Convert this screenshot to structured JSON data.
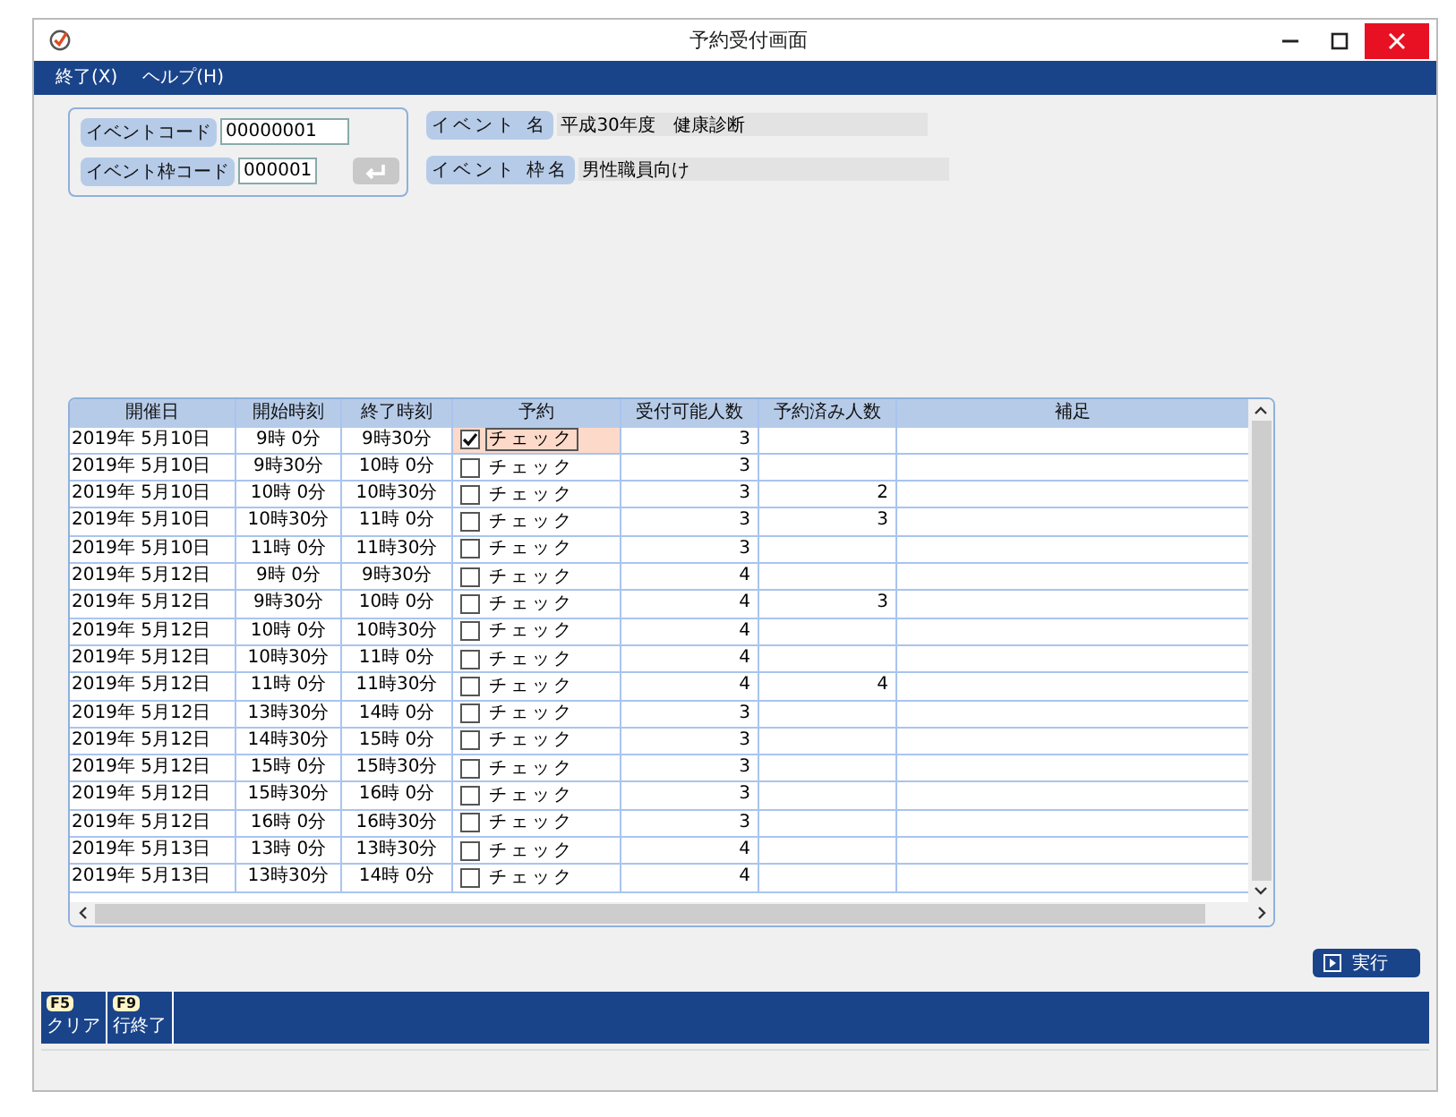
{
  "window": {
    "title": "予約受付画面"
  },
  "menu": [
    {
      "label": "終了(X)"
    },
    {
      "label": "ヘルプ(H)"
    }
  ],
  "form": {
    "event_code": {
      "label": "イベントコード",
      "value": "00000001"
    },
    "slot_code": {
      "label": "イベント枠コード",
      "value": "000001"
    },
    "event_name": {
      "label": "イベント 名",
      "value": "平成30年度　健康診断"
    },
    "slot_name": {
      "label": "イベント 枠名",
      "value": "男性職員向け"
    }
  },
  "table": {
    "columns": [
      "開催日",
      "開始時刻",
      "終了時刻",
      "予約",
      "受付可能人数",
      "予約済み人数",
      "補足"
    ],
    "rows": [
      {
        "date": "2019年 5月10日",
        "start": "9時 0分",
        "end": "9時30分",
        "check": "チェック",
        "checked": true,
        "selected": true,
        "capacity": "3",
        "booked": ""
      },
      {
        "date": "2019年 5月10日",
        "start": "9時30分",
        "end": "10時 0分",
        "check": "チェック",
        "checked": false,
        "selected": false,
        "capacity": "3",
        "booked": ""
      },
      {
        "date": "2019年 5月10日",
        "start": "10時 0分",
        "end": "10時30分",
        "check": "チェック",
        "checked": false,
        "selected": false,
        "capacity": "3",
        "booked": "2"
      },
      {
        "date": "2019年 5月10日",
        "start": "10時30分",
        "end": "11時 0分",
        "check": "チェック",
        "checked": false,
        "selected": false,
        "capacity": "3",
        "booked": "3"
      },
      {
        "date": "2019年 5月10日",
        "start": "11時 0分",
        "end": "11時30分",
        "check": "チェック",
        "checked": false,
        "selected": false,
        "capacity": "3",
        "booked": ""
      },
      {
        "date": "2019年 5月12日",
        "start": "9時 0分",
        "end": "9時30分",
        "check": "チェック",
        "checked": false,
        "selected": false,
        "capacity": "4",
        "booked": ""
      },
      {
        "date": "2019年 5月12日",
        "start": "9時30分",
        "end": "10時 0分",
        "check": "チェック",
        "checked": false,
        "selected": false,
        "capacity": "4",
        "booked": "3"
      },
      {
        "date": "2019年 5月12日",
        "start": "10時 0分",
        "end": "10時30分",
        "check": "チェック",
        "checked": false,
        "selected": false,
        "capacity": "4",
        "booked": ""
      },
      {
        "date": "2019年 5月12日",
        "start": "10時30分",
        "end": "11時 0分",
        "check": "チェック",
        "checked": false,
        "selected": false,
        "capacity": "4",
        "booked": ""
      },
      {
        "date": "2019年 5月12日",
        "start": "11時 0分",
        "end": "11時30分",
        "check": "チェック",
        "checked": false,
        "selected": false,
        "capacity": "4",
        "booked": "4"
      },
      {
        "date": "2019年 5月12日",
        "start": "13時30分",
        "end": "14時 0分",
        "check": "チェック",
        "checked": false,
        "selected": false,
        "capacity": "3",
        "booked": ""
      },
      {
        "date": "2019年 5月12日",
        "start": "14時30分",
        "end": "15時 0分",
        "check": "チェック",
        "checked": false,
        "selected": false,
        "capacity": "3",
        "booked": ""
      },
      {
        "date": "2019年 5月12日",
        "start": "15時 0分",
        "end": "15時30分",
        "check": "チェック",
        "checked": false,
        "selected": false,
        "capacity": "3",
        "booked": ""
      },
      {
        "date": "2019年 5月12日",
        "start": "15時30分",
        "end": "16時 0分",
        "check": "チェック",
        "checked": false,
        "selected": false,
        "capacity": "3",
        "booked": ""
      },
      {
        "date": "2019年 5月12日",
        "start": "16時 0分",
        "end": "16時30分",
        "check": "チェック",
        "checked": false,
        "selected": false,
        "capacity": "3",
        "booked": ""
      },
      {
        "date": "2019年 5月13日",
        "start": "13時 0分",
        "end": "13時30分",
        "check": "チェック",
        "checked": false,
        "selected": false,
        "capacity": "4",
        "booked": ""
      },
      {
        "date": "2019年 5月13日",
        "start": "13時30分",
        "end": "14時 0分",
        "check": "チェック",
        "checked": false,
        "selected": false,
        "capacity": "4",
        "booked": ""
      }
    ]
  },
  "run_button": {
    "label": "実行"
  },
  "function_keys": [
    {
      "key": "F5",
      "label": "クリア"
    },
    {
      "key": "F9",
      "label": "行終了"
    }
  ]
}
